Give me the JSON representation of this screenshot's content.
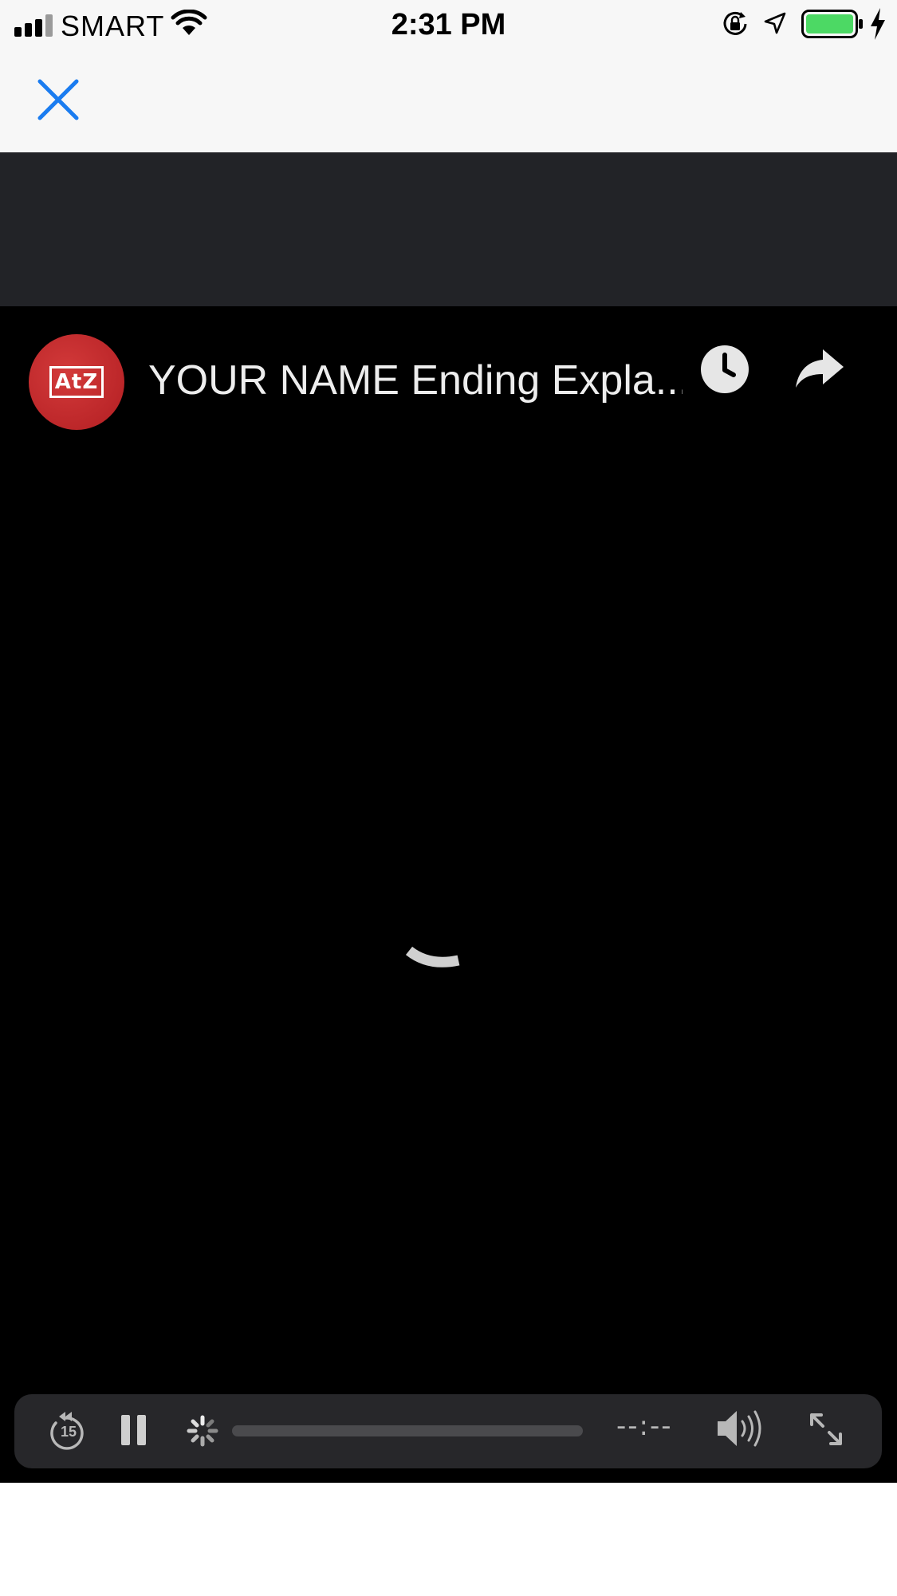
{
  "status_bar": {
    "carrier": "SMART",
    "time": "2:31 PM",
    "battery_color": "#4cd964",
    "icons": [
      "signal-icon",
      "wifi-icon",
      "orientation-lock-icon",
      "location-icon",
      "battery-icon",
      "charging-icon"
    ]
  },
  "nav": {
    "close_icon": "close-icon",
    "accent": "#1a7cf0"
  },
  "video": {
    "channel_logo": "AtZ",
    "title": "YOUR NAME Ending Expla...",
    "header_icons": [
      "watch-later-icon",
      "share-icon"
    ],
    "loading": true
  },
  "controls": {
    "icons": [
      "rewind-15-icon",
      "pause-icon",
      "buffering-icon",
      "volume-icon",
      "fullscreen-icon"
    ],
    "rewind_label": "15",
    "time_display": "--:--",
    "progress": 0
  }
}
